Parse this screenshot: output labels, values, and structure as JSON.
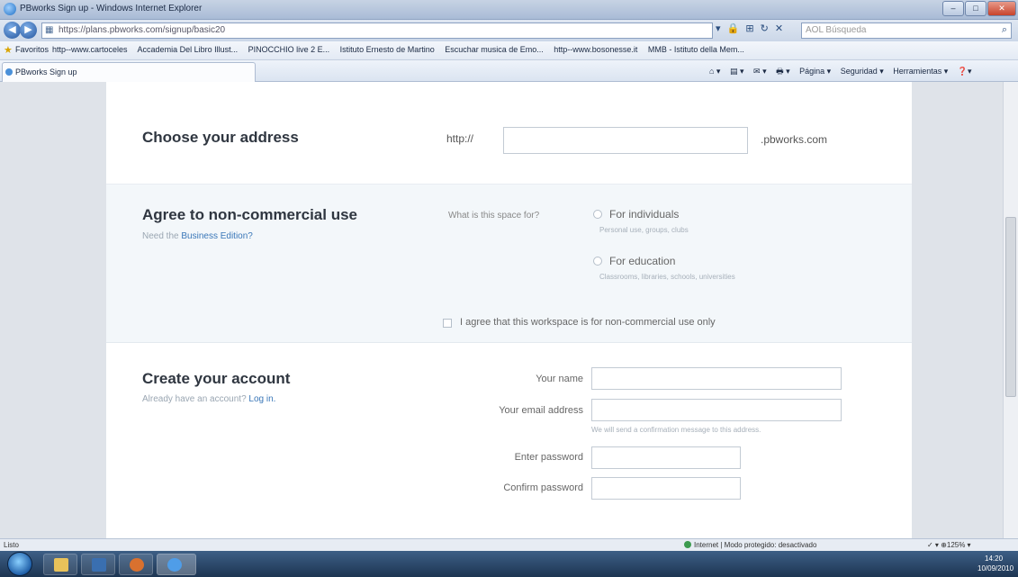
{
  "window": {
    "title": "PBworks Sign up - Windows Internet Explorer",
    "minimize": "–",
    "maximize": "□",
    "close": "✕"
  },
  "address_bar": {
    "back": "◀",
    "forward": "▶",
    "url": "https://plans.pbworks.com/signup/basic20",
    "tools": "▾ 🔒 ⊞ ↻ ✕",
    "search_placeholder": "AOL Búsqueda",
    "search_icon": "⌕"
  },
  "favorites_bar": {
    "label": "Favoritos",
    "items": [
      "http--www.cartoceles",
      "Accademia Del Libro Illust...",
      "PINOCCHIO live 2 E...",
      "Istituto Ernesto de Martino",
      "Escuchar musica de Emo...",
      "http--www.bosonesse.it",
      "MMB - Istituto della Mem..."
    ]
  },
  "tabs": [
    {
      "label": "PBworks Sign up"
    }
  ],
  "command_bar": {
    "items": [
      "⌂ ▾",
      "▤ ▾",
      "✉ ▾",
      "🖶 ▾",
      "Página ▾",
      "Seguridad ▾",
      "Herramientas ▾",
      "❓▾"
    ]
  },
  "address_section": {
    "title": "Choose your address",
    "prefix": "http://",
    "suffix": ".pbworks.com",
    "input_value": ""
  },
  "agree_section": {
    "title": "Agree to non-commercial use",
    "sub_text": "Need the ",
    "sub_link": "Business Edition?",
    "question": "What is this space for?",
    "options": [
      {
        "label": "For individuals",
        "hint": "Personal use, groups, clubs"
      },
      {
        "label": "For education",
        "hint": "Classrooms, libraries, schools, universities"
      }
    ],
    "checkbox_label": "I agree that this workspace is for non-commercial use only"
  },
  "account_section": {
    "title": "Create your account",
    "sub_text": "Already have an account? ",
    "sub_link": "Log in.",
    "fields": [
      {
        "label": "Your name",
        "value": ""
      },
      {
        "label": "Your email address",
        "value": "",
        "hint": "We will send a confirmation message to this address."
      },
      {
        "label": "Enter password",
        "value": ""
      },
      {
        "label": "Confirm password",
        "value": ""
      }
    ]
  },
  "status_bar": {
    "left": "Listo",
    "zone": "Internet | Modo protegido: desactivado",
    "zoom": "✓ ▾  ⊕125%  ▾"
  },
  "taskbar": {
    "clock_time": "14:20",
    "clock_date": "10/09/2010"
  },
  "colors": {
    "page_background": "#ffffff",
    "agree_background": "#f3f7fa",
    "link": "#3a77b8",
    "title_text": "#2f3640"
  }
}
